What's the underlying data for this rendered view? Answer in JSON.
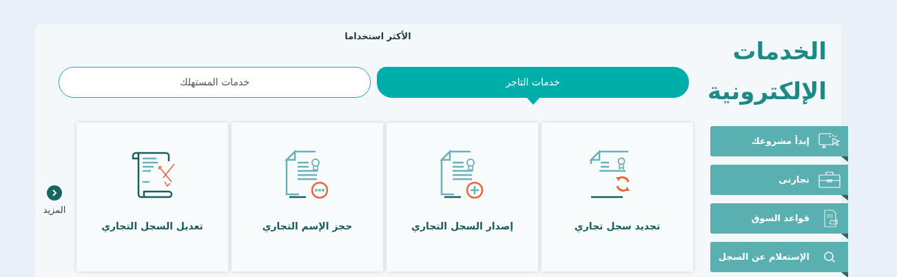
{
  "section_title_lines": [
    "الخدمات",
    "الإلكترونية"
  ],
  "quick_links": [
    {
      "label": "إبدأ مشروعك"
    },
    {
      "label": "تجارتى"
    },
    {
      "label": "قواعد السوق"
    },
    {
      "label": "الإستعلام عن السجل"
    }
  ],
  "most_used_heading": "الأكثر استخداما",
  "tabs": [
    {
      "label": "خدمات التاجر",
      "selected": true
    },
    {
      "label": "خدمات المستهلك",
      "selected": false
    }
  ],
  "services": [
    {
      "title": "تجديد سجل تجاري"
    },
    {
      "title": "إصدار السجل التجاري"
    },
    {
      "title": "حجز الإسم التجاري"
    },
    {
      "title": "تعديل السجل التجاري"
    }
  ],
  "more_button": {
    "label": "المزيد"
  }
}
